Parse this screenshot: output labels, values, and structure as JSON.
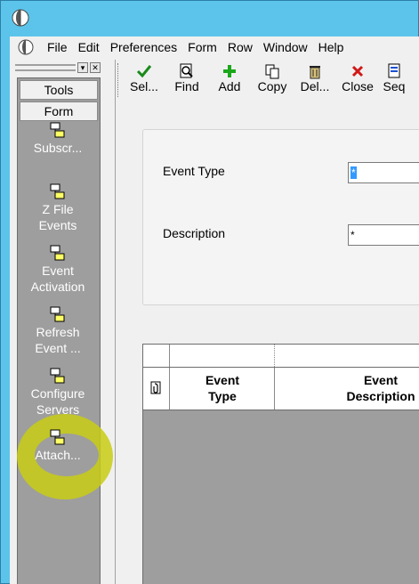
{
  "menubar": {
    "items": [
      "File",
      "Edit",
      "Preferences",
      "Form",
      "Row",
      "Window",
      "Help"
    ]
  },
  "left_panel": {
    "tabs": [
      "Tools",
      "Form"
    ],
    "exits": [
      {
        "label": "Subscr..."
      },
      {
        "label": "Z File\nEvents"
      },
      {
        "label": "Event\nActivation"
      },
      {
        "label": "Refresh\nEvent ..."
      },
      {
        "label": "Configure\nServers",
        "highlighted": true
      },
      {
        "label": "Attach..."
      }
    ],
    "highlight_color": "#c8cd14"
  },
  "toolbar": {
    "buttons": [
      {
        "label": "Sel...",
        "icon": "checkmark-icon"
      },
      {
        "label": "Find",
        "icon": "find-icon"
      },
      {
        "label": "Add",
        "icon": "plus-icon"
      },
      {
        "label": "Copy",
        "icon": "copy-icon"
      },
      {
        "label": "Del...",
        "icon": "trash-icon"
      },
      {
        "label": "Close",
        "icon": "close-icon"
      },
      {
        "label": "Seq",
        "icon": "sequence-icon"
      }
    ]
  },
  "form": {
    "event_type_label": "Event Type",
    "event_type_value": "*",
    "description_label": "Description",
    "description_value": "*"
  },
  "grid": {
    "columns": [
      "Event\nType",
      "Event\nDescription"
    ]
  },
  "colors": {
    "window_border": "#5cc4ea",
    "panel_gray": "#9e9e9e"
  }
}
